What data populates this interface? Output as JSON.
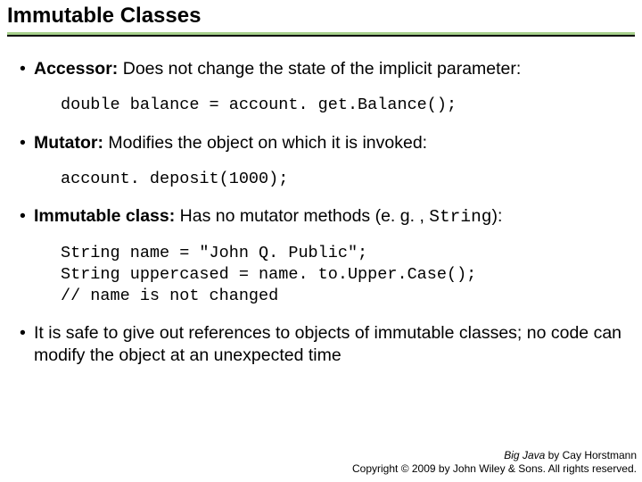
{
  "title": "Immutable Classes",
  "bullets": {
    "b1_label": "Accessor:",
    "b1_text": " Does not change the state of the implicit parameter:",
    "code1": "double balance = account. get.Balance();",
    "b2_label": "Mutator:",
    "b2_text": " Modifies the object on which it is invoked:",
    "code2": "account. deposit(1000);",
    "b3_label": "Immutable class:",
    "b3_text_a": " Has no mutator methods (e. g. , ",
    "b3_code": "String",
    "b3_text_b": "):",
    "code3": "String name = \"John Q. Public\";\nString uppercased = name. to.Upper.Case();\n// name is not changed",
    "b4_text": "It is safe to give out references to objects of immutable classes; no code can modify the object at an unexpected time"
  },
  "footer": {
    "book": "Big Java",
    "author": " by Cay Horstmann",
    "copyright": "Copyright © 2009 by John Wiley & Sons.  All rights reserved."
  }
}
